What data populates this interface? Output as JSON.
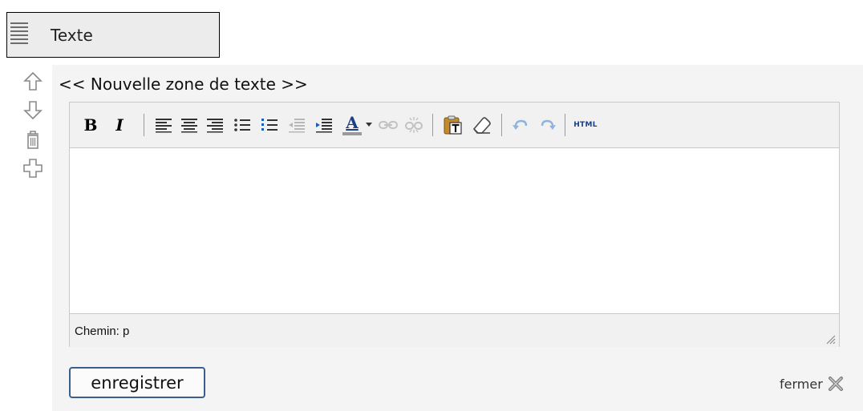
{
  "block": {
    "title": "Texte",
    "icon": "paragraph-lines-icon"
  },
  "side_actions": [
    {
      "name": "move-up-icon"
    },
    {
      "name": "move-down-icon"
    },
    {
      "name": "trash-icon"
    },
    {
      "name": "add-plus-icon"
    }
  ],
  "zone": {
    "title": "<< Nouvelle zone de texte >>"
  },
  "toolbar": {
    "bold": "B",
    "italic": "I",
    "text_color": "A",
    "html": "HTML"
  },
  "status": {
    "path": "Chemin: p"
  },
  "footer": {
    "save_label": "enregistrer",
    "close_label": "fermer"
  },
  "colors": {
    "accent": "#3c5e8a",
    "text_color_bar": "#9a9a9a"
  }
}
